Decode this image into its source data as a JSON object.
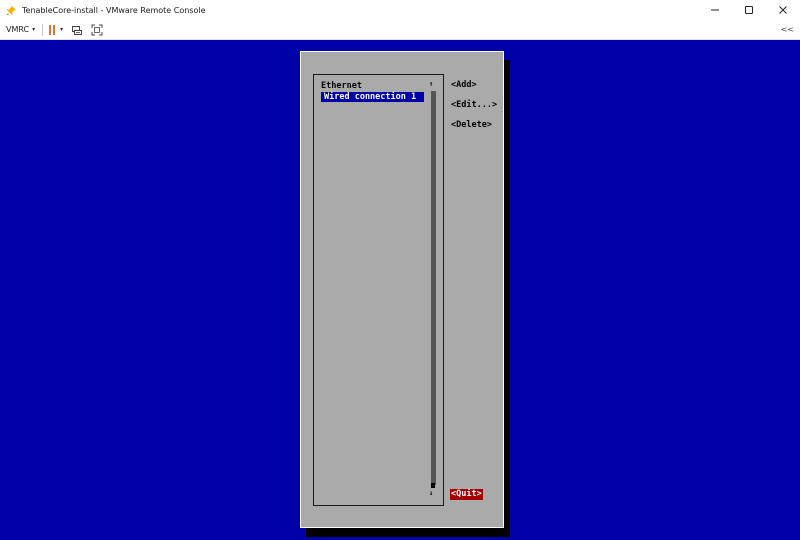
{
  "window": {
    "title": "TenableCore-install - VMware Remote Console",
    "controls": {
      "minimize": "—",
      "maximize": "☐",
      "close": "✕"
    }
  },
  "toolbar": {
    "menu_label": "VMRC",
    "menu_caret": "▾",
    "power_caret": "▾",
    "collapse_label": "<<"
  },
  "tui": {
    "list_heading": "Ethernet",
    "connections": [
      "Wired connection 1"
    ],
    "scroll_up": "↑",
    "scroll_down": "↓",
    "actions": {
      "add": "<Add>",
      "edit": "<Edit...>",
      "delete": "<Delete>",
      "quit": "<Quit>"
    }
  },
  "colors": {
    "console_bg": "#0000a8",
    "dialog_bg": "#aaaaaa",
    "selection_bg": "#0000a8",
    "quit_bg": "#a80000",
    "pause_icon": "#e8722c"
  },
  "icons": {
    "app": "pin-icon",
    "pause": "pause-icon",
    "send-keys": "keyboard-icon",
    "fullscreen": "fullscreen-icon"
  }
}
